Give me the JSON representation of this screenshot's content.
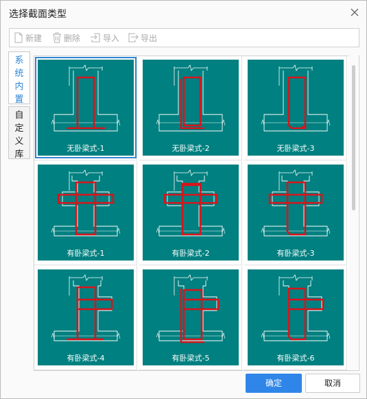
{
  "dialog": {
    "title": "选择截面类型"
  },
  "toolbar": {
    "new_label": "新建",
    "delete_label": "删除",
    "import_label": "导入",
    "export_label": "导出"
  },
  "tabs": [
    {
      "label": "系统内置",
      "active": true
    },
    {
      "label": "自定义库",
      "active": false
    }
  ],
  "sections": [
    {
      "label": "无卧梁式-1",
      "kind": "none",
      "variant": 1,
      "selected": true
    },
    {
      "label": "无卧梁式-2",
      "kind": "none",
      "variant": 2
    },
    {
      "label": "无卧梁式-3",
      "kind": "none",
      "variant": 3
    },
    {
      "label": "有卧梁式-1",
      "kind": "cross",
      "variant": 1
    },
    {
      "label": "有卧梁式-2",
      "kind": "cross",
      "variant": 2
    },
    {
      "label": "有卧梁式-3",
      "kind": "cross",
      "variant": 3
    },
    {
      "label": "有卧梁式-4",
      "kind": "half",
      "variant": 1
    },
    {
      "label": "有卧梁式-5",
      "kind": "half",
      "variant": 2
    },
    {
      "label": "有卧梁式-6",
      "kind": "half",
      "variant": 3
    }
  ],
  "buttons": {
    "ok_label": "确定",
    "cancel_label": "取消"
  },
  "colors": {
    "card_bg": "#008080",
    "rebar": "#d9141b",
    "outline": "#ffffff",
    "accent": "#2f86e8"
  }
}
